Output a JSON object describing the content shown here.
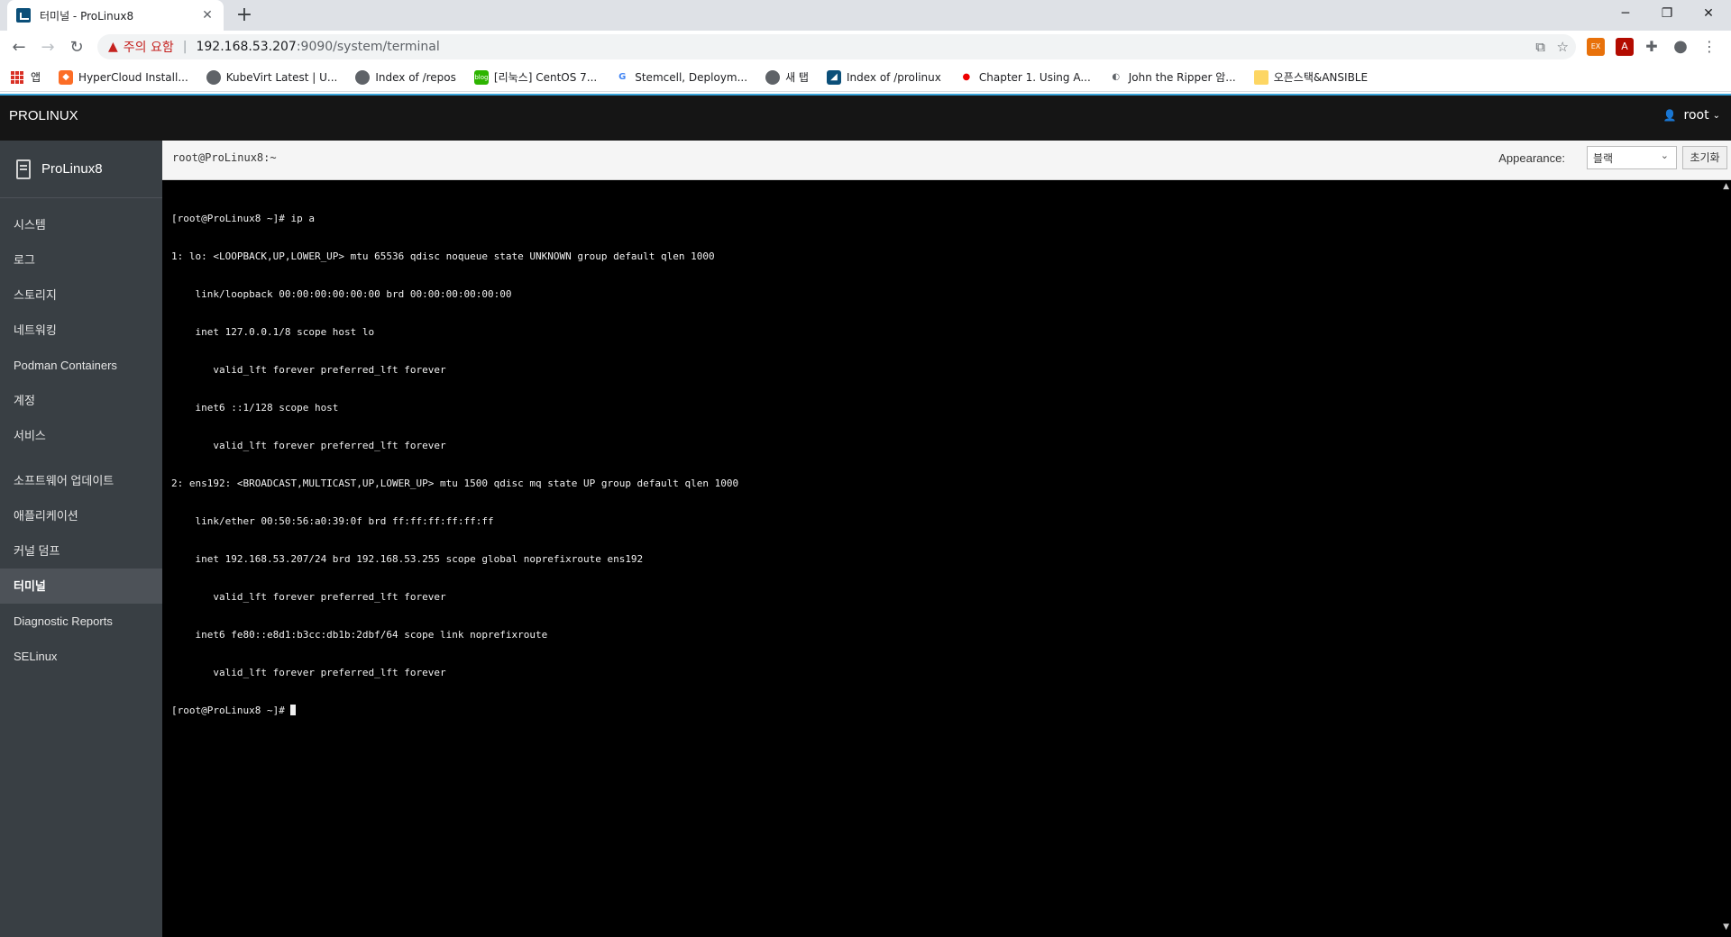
{
  "browser": {
    "tab_title": "터미널 - ProLinux8",
    "new_tab": "+",
    "warning": "주의 요함",
    "url_host": "192.168.53.207",
    "url_path": ":9090/system/terminal",
    "bookmarks": [
      {
        "label": "앱",
        "icon": "apps-grid-icon"
      },
      {
        "label": "HyperCloud Install...",
        "icon": "gitlab-icon"
      },
      {
        "label": "KubeVirt Latest | U...",
        "icon": "globe-icon"
      },
      {
        "label": "Index of /repos",
        "icon": "globe-icon"
      },
      {
        "label": "[리눅스] CentOS 7...",
        "icon": "blog-icon"
      },
      {
        "label": "Stemcell, Deploym...",
        "icon": "google-icon"
      },
      {
        "label": "새 탭",
        "icon": "globe-icon"
      },
      {
        "label": "Index of /prolinux",
        "icon": "cockpit-icon"
      },
      {
        "label": "Chapter 1. Using A...",
        "icon": "redhat-icon"
      },
      {
        "label": "John the Ripper 암...",
        "icon": "loading-icon"
      },
      {
        "label": "오픈스택&ANSIBLE",
        "icon": "folder-icon"
      }
    ]
  },
  "app": {
    "brand": "PROLINUX",
    "user": "root",
    "host": "ProLinux8",
    "nav": [
      "시스템",
      "로그",
      "스토리지",
      "네트워킹",
      "Podman Containers",
      "계정",
      "서비스",
      "소프트웨어 업데이트",
      "애플리케이션",
      "커널 덤프",
      "터미널",
      "Diagnostic Reports",
      "SELinux"
    ],
    "active_nav": "터미널"
  },
  "terminal": {
    "title": "root@ProLinux8:~",
    "appearance_label": "Appearance:",
    "appearance_value": "블랙",
    "reset_label": "초기화",
    "lines": [
      "[root@ProLinux8 ~]# ip a",
      "1: lo: <LOOPBACK,UP,LOWER_UP> mtu 65536 qdisc noqueue state UNKNOWN group default qlen 1000",
      "    link/loopback 00:00:00:00:00:00 brd 00:00:00:00:00:00",
      "    inet 127.0.0.1/8 scope host lo",
      "       valid_lft forever preferred_lft forever",
      "    inet6 ::1/128 scope host",
      "       valid_lft forever preferred_lft forever",
      "2: ens192: <BROADCAST,MULTICAST,UP,LOWER_UP> mtu 1500 qdisc mq state UP group default qlen 1000",
      "    link/ether 00:50:56:a0:39:0f brd ff:ff:ff:ff:ff:ff",
      "    inet 192.168.53.207/24 brd 192.168.53.255 scope global noprefixroute ens192",
      "       valid_lft forever preferred_lft forever",
      "    inet6 fe80::e8d1:b3cc:db1b:2dbf/64 scope link noprefixroute",
      "       valid_lft forever preferred_lft forever"
    ],
    "prompt": "[root@ProLinux8 ~]# "
  }
}
